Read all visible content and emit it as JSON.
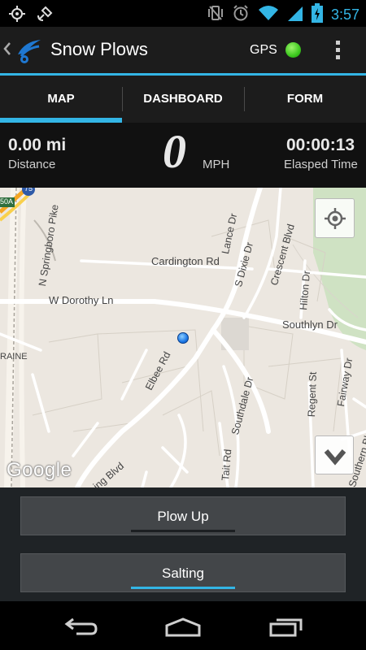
{
  "status_bar": {
    "time": "3:57",
    "icons": [
      "gps-fix-icon",
      "satellite-icon",
      "vibrate-icon",
      "alarm-icon",
      "wifi-icon",
      "signal-icon",
      "battery-charging-icon"
    ]
  },
  "action_bar": {
    "title": "Snow Plows",
    "gps_label": "GPS",
    "gps_status_color": "#3cc81e"
  },
  "tabs": [
    {
      "label": "MAP",
      "active": true
    },
    {
      "label": "DASHBOARD",
      "active": false
    },
    {
      "label": "FORM",
      "active": false
    }
  ],
  "stats": {
    "distance_value": "0.00 mi",
    "distance_label": "Distance",
    "speed_value": "0",
    "speed_unit": "MPH",
    "elapsed_value": "00:00:13",
    "elapsed_label": "Elasped Time"
  },
  "map": {
    "streets": {
      "springboro": "N Springboro Pike",
      "cardington": "Cardington Rd",
      "lance": "Lance Dr",
      "s_dixie": "S Dixie Dr",
      "crescent": "Crescent Blvd",
      "hilton": "Hilton Dr",
      "w_dorothy": "W Dorothy Ln",
      "southlyn": "Southlyn Dr",
      "elbee": "Elbee Rd",
      "regent": "Regent St",
      "fairway": "Fairway Dr",
      "southdale": "Southdale Dr",
      "tait": "Tait Rd",
      "southern": "Southern Blvd",
      "ing_blvd": "ing Blvd",
      "raine": "RAINE",
      "shield_75": "75",
      "shield_50a": "50A"
    },
    "attribution": "Google"
  },
  "buttons": {
    "plow": {
      "label": "Plow Up",
      "indicator_color": "#1c1f22"
    },
    "salt": {
      "label": "Salting",
      "indicator_color": "#33b5e5"
    }
  },
  "colors": {
    "accent": "#33b5e5",
    "actionbar_bg": "#1c1c1c"
  }
}
